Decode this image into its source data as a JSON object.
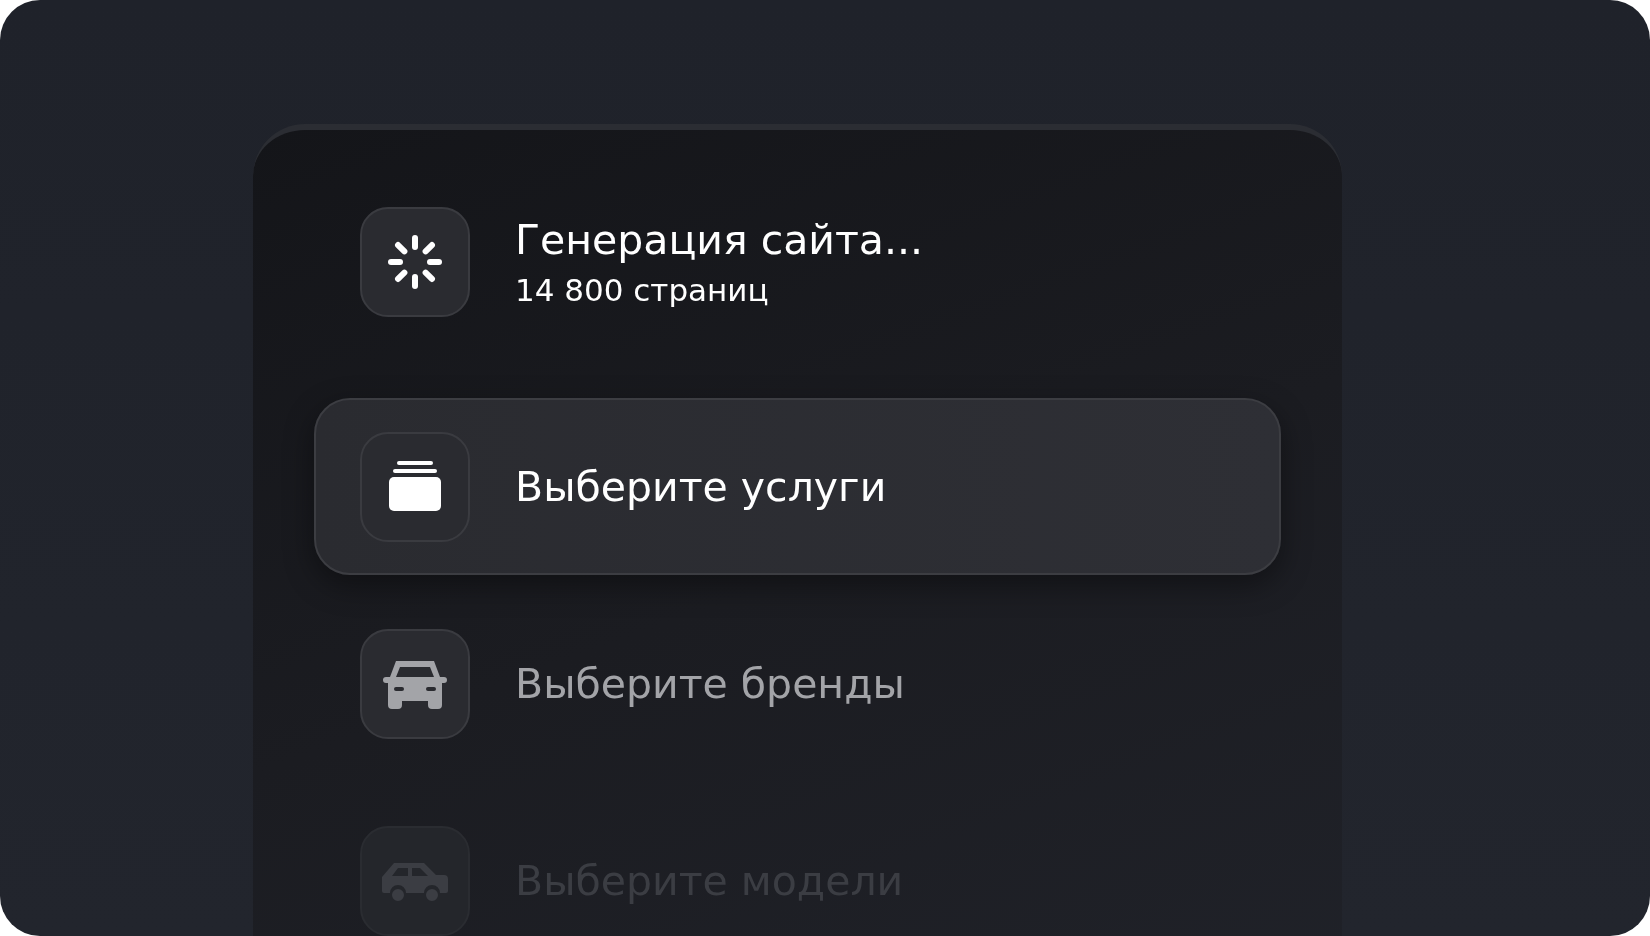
{
  "steps": [
    {
      "kind": "progress",
      "title": "Генерация сайта...",
      "subtitle": "14 800 страниц",
      "selected": false,
      "disabled": false,
      "faded": false
    },
    {
      "kind": "services",
      "title": "Выберите услуги",
      "selected": true,
      "disabled": false,
      "faded": false
    },
    {
      "kind": "brands",
      "title": "Выберите бренды",
      "selected": false,
      "disabled": true,
      "faded": false
    },
    {
      "kind": "models",
      "title": "Выберите модели",
      "selected": false,
      "disabled": true,
      "faded": true
    }
  ]
}
